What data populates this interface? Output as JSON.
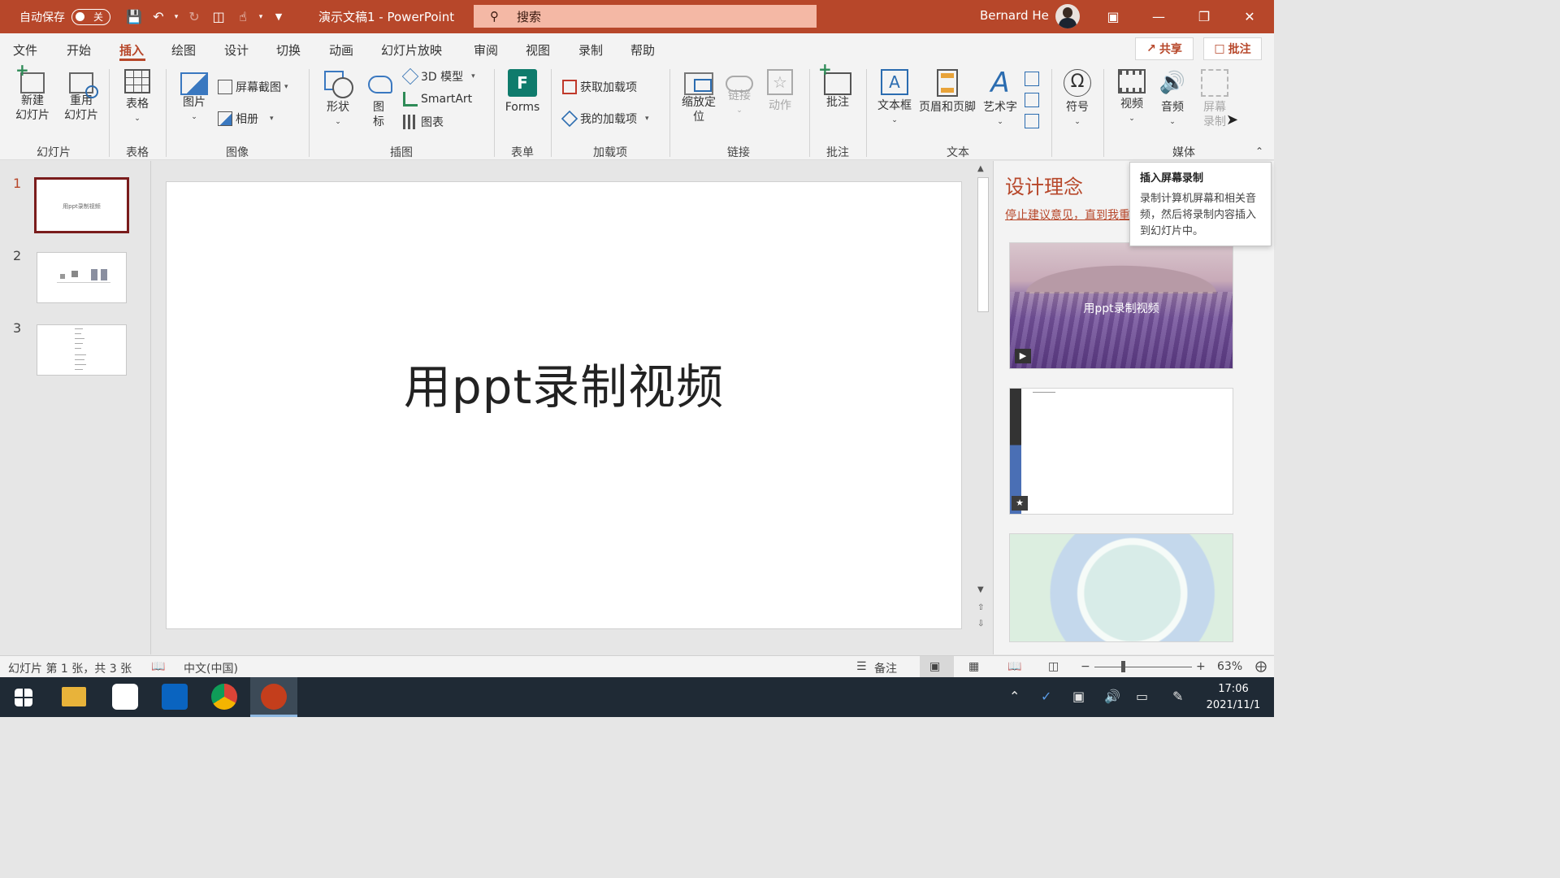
{
  "titlebar": {
    "autosave_label": "自动保存",
    "autosave_state": "关",
    "doc_title": "演示文稿1 - PowerPoint",
    "search_placeholder": "搜索",
    "user_name": "Bernard He",
    "accent": "#b7472a"
  },
  "tabs": [
    {
      "label": "文件"
    },
    {
      "label": "开始"
    },
    {
      "label": "插入"
    },
    {
      "label": "绘图"
    },
    {
      "label": "设计"
    },
    {
      "label": "切换"
    },
    {
      "label": "动画"
    },
    {
      "label": "幻灯片放映"
    },
    {
      "label": "审阅"
    },
    {
      "label": "视图"
    },
    {
      "label": "录制"
    },
    {
      "label": "帮助"
    }
  ],
  "active_tab": "插入",
  "share_label": "共享",
  "comments_label": "批注",
  "ribbon": {
    "new_slide": "新建\n幻灯片",
    "reuse_slide": "重用\n幻灯片",
    "table": "表格",
    "picture": "图片",
    "screenshot": "屏幕截图",
    "album": "相册",
    "shapes": "形状",
    "icons": "图\n标",
    "model3d": "3D 模型",
    "smartart": "SmartArt",
    "chart": "图表",
    "forms": "Forms",
    "get_addins": "获取加载项",
    "my_addins": "我的加载项",
    "zoom": "缩放定\n位",
    "link": "链接",
    "action": "动作",
    "comment": "批注",
    "textbox": "文本框",
    "header_footer": "页眉和页脚",
    "wordart": "艺术字",
    "symbols": "符号",
    "video": "视频",
    "audio": "音频",
    "screen_record": "屏幕\n录制",
    "groups": {
      "slides": "幻灯片",
      "tables": "表格",
      "images": "图像",
      "illustrations": "插图",
      "forms": "表单",
      "addins": "加载项",
      "links": "链接",
      "comments": "批注",
      "text": "文本",
      "media": "媒体"
    }
  },
  "thumbnails": [
    {
      "num": "1",
      "title": "用ppt录制视频"
    },
    {
      "num": "2"
    },
    {
      "num": "3"
    }
  ],
  "slide": {
    "title": "用ppt录制视频"
  },
  "designer": {
    "title": "设计理念",
    "stop_link": "停止建议意见，直到我重",
    "card1_text": "用ppt录制视频"
  },
  "tooltip": {
    "title": "插入屏幕录制",
    "body": "录制计算机屏幕和相关音频，然后将录制内容插入到幻灯片中。"
  },
  "statusbar": {
    "slide_info": "幻灯片 第 1 张，共 3 张",
    "language": "中文(中国)",
    "notes": "备注",
    "zoom": "63%"
  },
  "taskbar": {
    "time": "17:06",
    "date": "2021/11/1"
  }
}
